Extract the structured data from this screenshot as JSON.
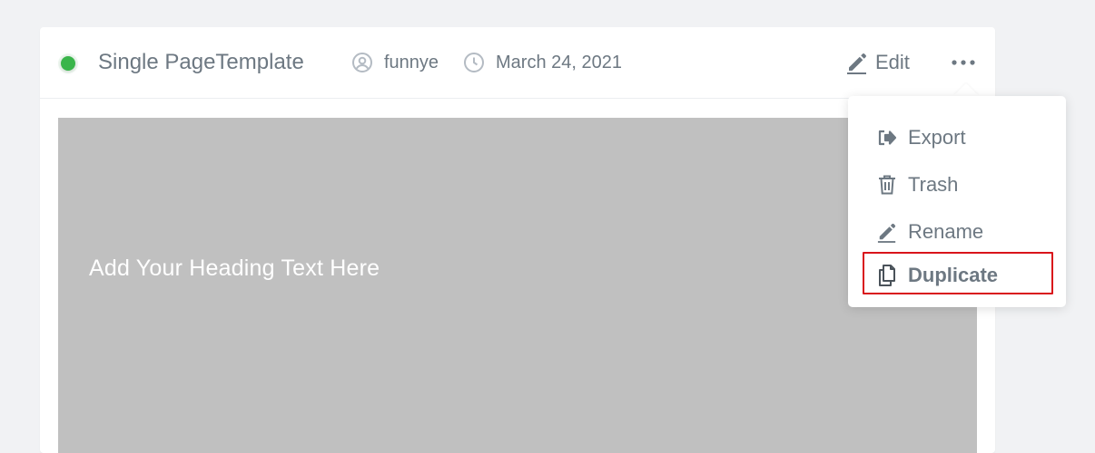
{
  "template": {
    "title": "Single PageTemplate",
    "status_color": "#39b54a"
  },
  "meta": {
    "author": "funnye",
    "date": "March 24, 2021"
  },
  "actions": {
    "edit_label": "Edit",
    "more_icon": "ellipsis-horizontal-icon"
  },
  "preview": {
    "heading": "Add Your Heading Text Here"
  },
  "menu": {
    "items": [
      {
        "label": "Export",
        "icon": "export-icon"
      },
      {
        "label": "Trash",
        "icon": "trash-icon"
      },
      {
        "label": "Rename",
        "icon": "pencil-icon"
      },
      {
        "label": "Duplicate",
        "icon": "duplicate-icon"
      }
    ],
    "highlighted": "Duplicate",
    "highlight_color": "#d9141b"
  },
  "colors": {
    "text": "#6d7882",
    "preview_bg": "#c0c0c0",
    "page_bg": "#f1f2f4"
  }
}
